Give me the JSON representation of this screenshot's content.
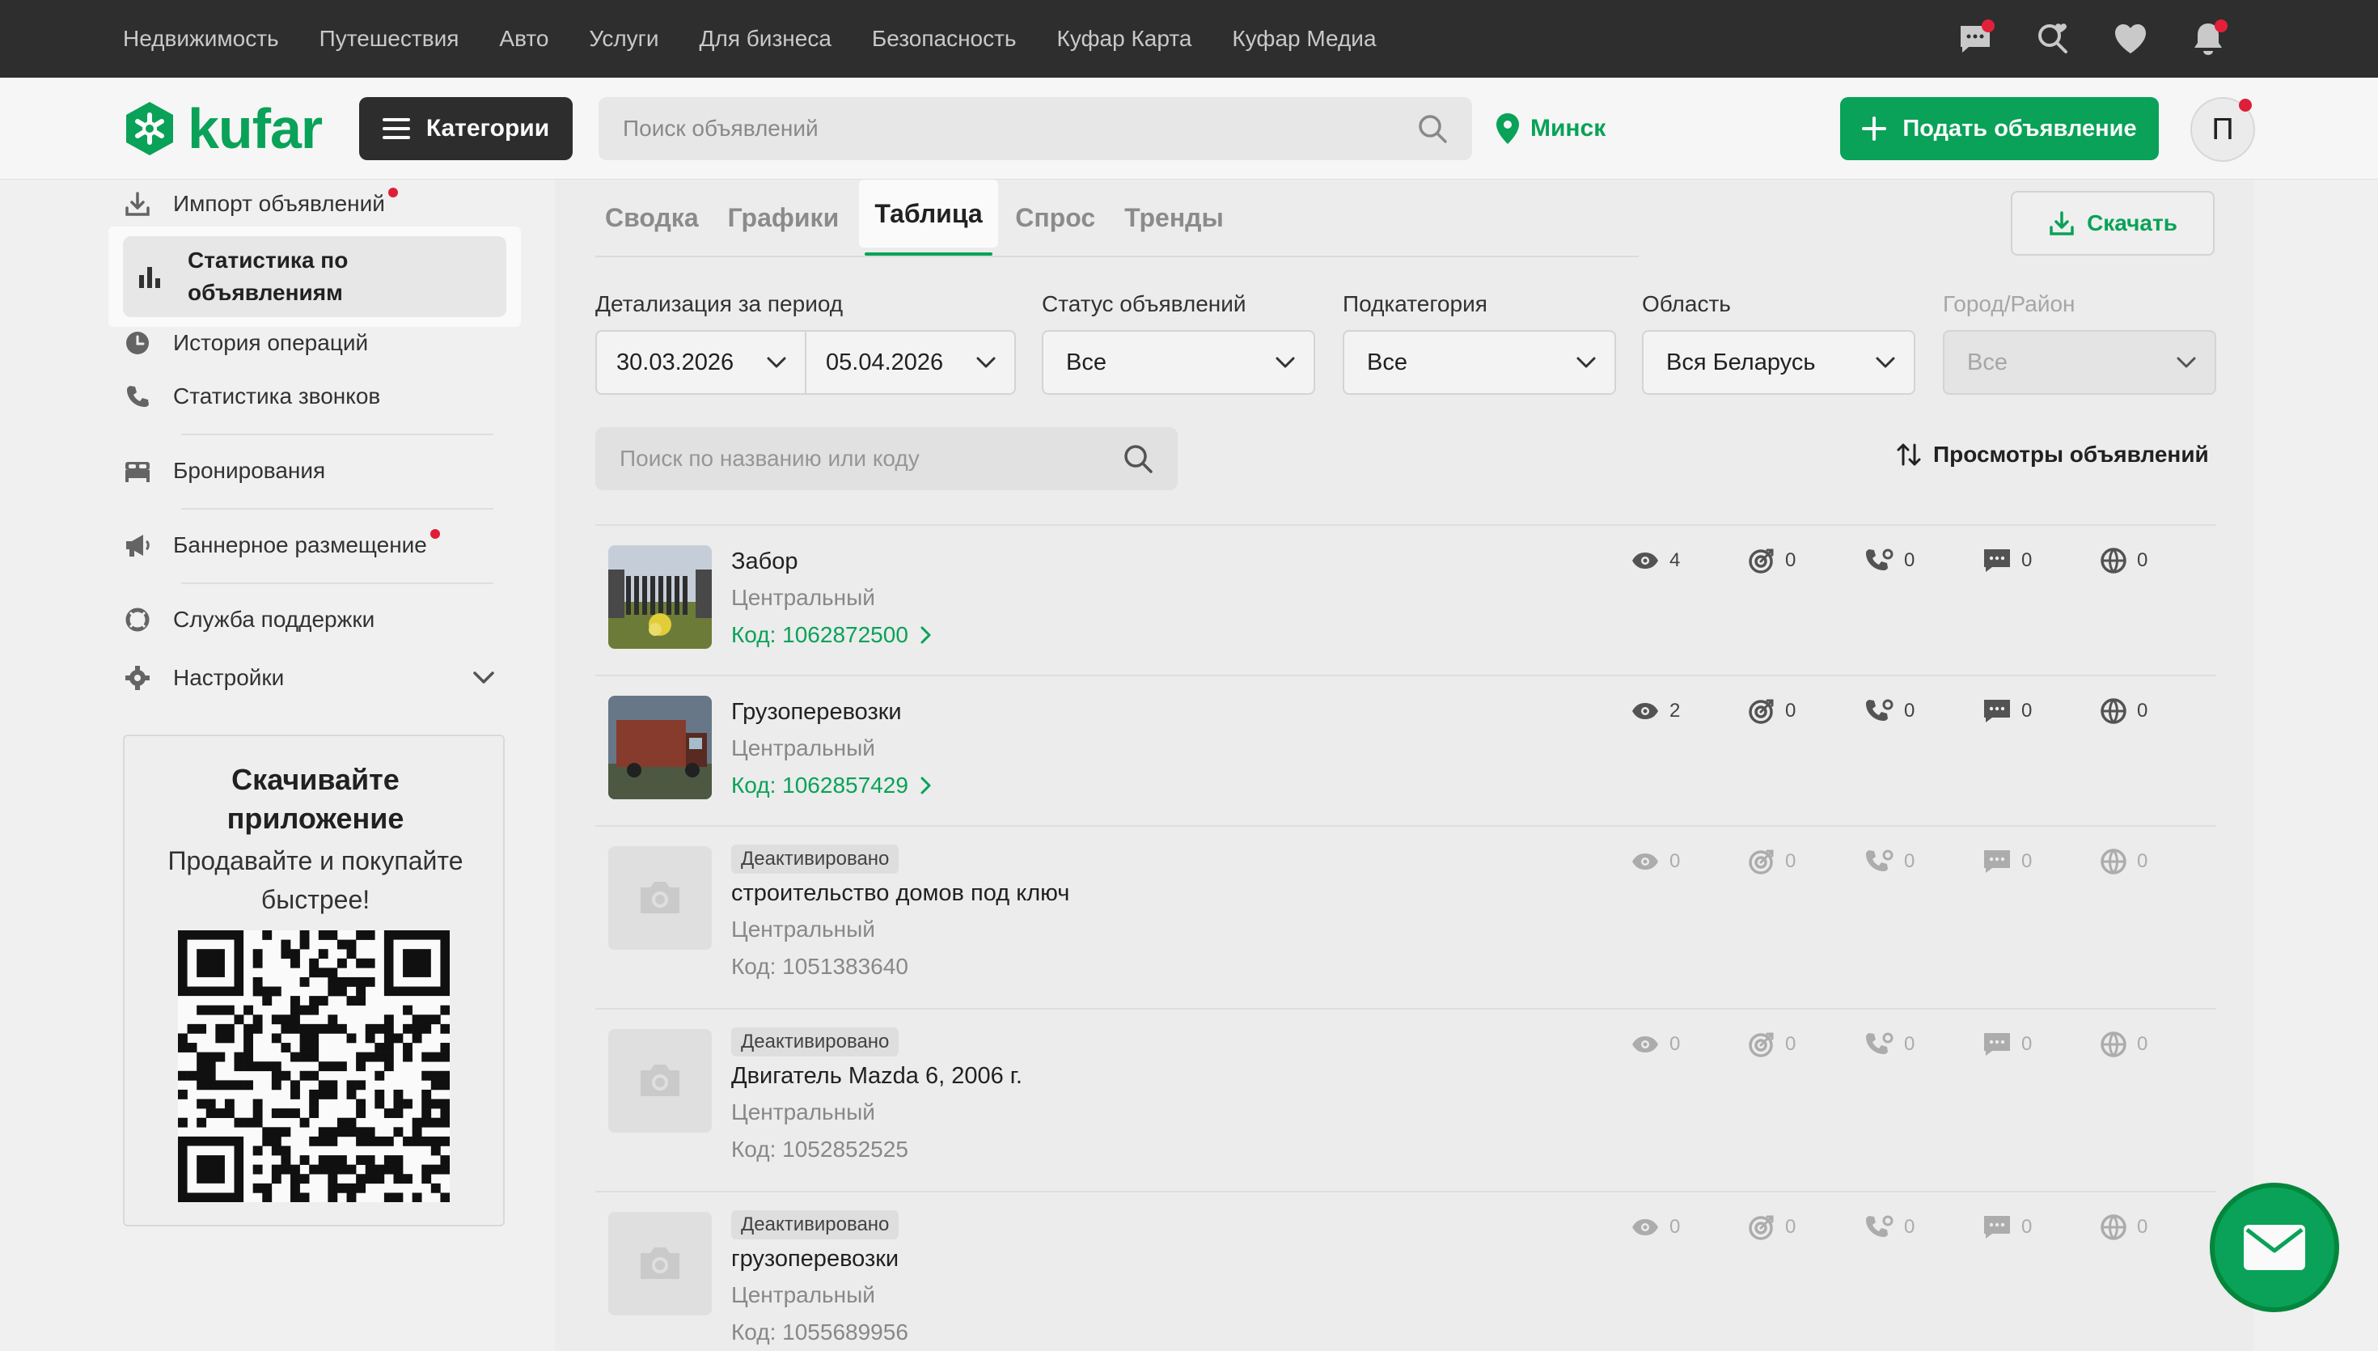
{
  "topnav": [
    "Недвижимость",
    "Путешествия",
    "Авто",
    "Услуги",
    "Для бизнеса",
    "Безопасность",
    "Куфар Карта",
    "Куфар Медиа"
  ],
  "header": {
    "logo": "kufar",
    "categories_label": "Категории",
    "search_placeholder": "Поиск объявлений",
    "city": "Минск",
    "post_label": "Подать объявление",
    "avatar_letter": "П"
  },
  "sidebar": {
    "import": "Импорт объявлений",
    "stats": "Статистика по объявлениям",
    "history": "История операций",
    "calls": "Статистика звонков",
    "bookings": "Бронирования",
    "banners": "Баннерное размещение",
    "support": "Служба поддержки",
    "settings": "Настройки",
    "app_title": "Скачивайте приложение",
    "app_sub": "Продавайте и покупайте быстрее!"
  },
  "tabs": [
    "Сводка",
    "Графики",
    "Таблица",
    "Спрос",
    "Тренды"
  ],
  "download_label": "Скачать",
  "filters": {
    "period_label": "Детализация за период",
    "date_from": "30.03.2026",
    "date_to": "05.04.2026",
    "status_label": "Статус объявлений",
    "status_value": "Все",
    "subcat_label": "Подкатегория",
    "subcat_value": "Все",
    "region_label": "Область",
    "region_value": "Вся Беларусь",
    "city_label": "Город/Район",
    "city_value": "Все"
  },
  "search_ads_placeholder": "Поиск по названию или коду",
  "sort_label": "Просмотры объявлений",
  "ads": [
    {
      "title": "Забор",
      "district": "Центральный",
      "code": "Код: 1062872500",
      "badge": "",
      "views": "4",
      "contacts": "0",
      "calls": "0",
      "messages": "0",
      "web": "0"
    },
    {
      "title": "Грузоперевозки",
      "district": "Центральный",
      "code": "Код: 1062857429",
      "badge": "",
      "views": "2",
      "contacts": "0",
      "calls": "0",
      "messages": "0",
      "web": "0"
    },
    {
      "title": "строительство домов под ключ",
      "district": "Центральный",
      "code": "Код: 1051383640",
      "badge": "Деактивировано",
      "views": "0",
      "contacts": "0",
      "calls": "0",
      "messages": "0",
      "web": "0"
    },
    {
      "title": "Двигатель Mazda 6, 2006 г.",
      "district": "Центральный",
      "code": "Код: 1052852525",
      "badge": "Деактивировано",
      "views": "0",
      "contacts": "0",
      "calls": "0",
      "messages": "0",
      "web": "0"
    },
    {
      "title": "грузоперевозки",
      "district": "Центральный",
      "code": "Код: 1055689956",
      "badge": "Деактивировано",
      "views": "0",
      "contacts": "0",
      "calls": "0",
      "messages": "0",
      "web": "0"
    }
  ],
  "colors": {
    "brand": "#0aa65a",
    "dark": "#2e2e2e",
    "alert": "#e3203a"
  }
}
